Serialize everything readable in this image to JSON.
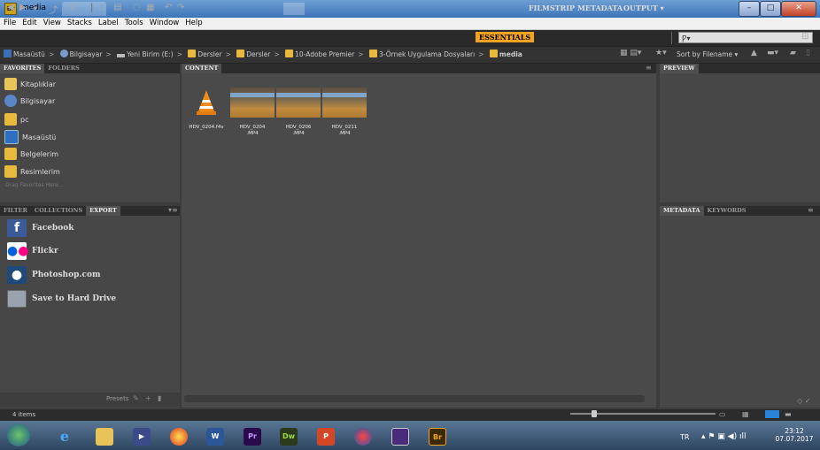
{
  "window": {
    "title": "media",
    "app_icon": "Br"
  },
  "titlebar": {
    "minimize": "–",
    "maximize": "□",
    "close": "✕"
  },
  "menu": [
    "File",
    "Edit",
    "View",
    "Stacks",
    "Label",
    "Tools",
    "Window",
    "Help"
  ],
  "workspaces": [
    "ESSENTIALS",
    "FILMSTRIP",
    "METADATA",
    "OUTPUT ▾"
  ],
  "search": {
    "placeholder": "Ƿ▾"
  },
  "breadcrumb": [
    "Masaüstü",
    "Bilgisayar",
    "Yeni Birim (E:)",
    "Dersler",
    "Dersler",
    "10-Adobe Premier",
    "3-Örnek Uygulama Dosyaları",
    "media"
  ],
  "sort": {
    "label": "Sort by Filename ▾"
  },
  "favorites_panel": {
    "tabs": [
      "FAVORITES",
      "FOLDERS"
    ],
    "items": [
      "Kitaplıklar",
      "Bilgisayar",
      "pc",
      "Masaüstü",
      "Belgelerim",
      "Resimlerim"
    ],
    "hint": "Drag Favorites Here..."
  },
  "export_panel": {
    "tabs": [
      "FILTER",
      "COLLECTIONS",
      "EXPORT"
    ],
    "items": [
      "Facebook",
      "Flickr",
      "Photoshop.com",
      "Save to Hard Drive"
    ],
    "presets_label": "Presets"
  },
  "content": {
    "tab": "CONTENT",
    "files": [
      {
        "name1": "HDV_0204.f4v",
        "name2": ""
      },
      {
        "name1": "HDV_0204",
        "name2": ".MP4"
      },
      {
        "name1": "HDV_0206",
        "name2": ".MP4"
      },
      {
        "name1": "HDV_0211",
        "name2": ".MP4"
      }
    ]
  },
  "preview_panel": {
    "tab": "PREVIEW"
  },
  "metadata_panel": {
    "tabs": [
      "METADATA",
      "KEYWORDS"
    ]
  },
  "status": {
    "item_count": "4 items"
  },
  "taskbar": {
    "apps": [
      "W",
      "Pr",
      "Dw",
      "P",
      "Br"
    ],
    "lang": "TR",
    "time": "23:12",
    "date": "07.07.2017"
  }
}
